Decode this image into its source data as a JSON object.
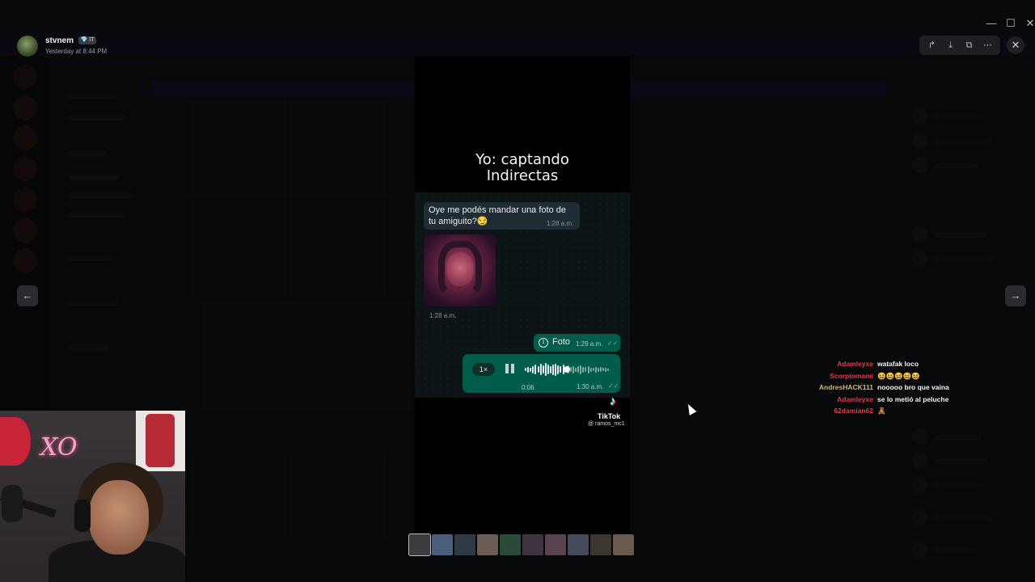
{
  "window": {
    "title": "",
    "controls": [
      "—",
      "☐",
      "✕"
    ]
  },
  "uploader": {
    "username": "stvnem",
    "badge": "💎 IT",
    "timestamp": "Yesterday at 8:44 PM"
  },
  "toolbar": {
    "share_icon": "↱",
    "download_icon": "⤓",
    "open_icon": "⧉",
    "more_icon": "⋯",
    "close_icon": "✕"
  },
  "nav": {
    "prev_icon": "←",
    "next_icon": "→"
  },
  "video": {
    "caption_line1": "Yo: captando",
    "caption_line2": "Indirectas",
    "incoming_message": "Oye me podés mandar una foto de tu amiguito?😏",
    "incoming_time": "1:28 a.m.",
    "photo_time": "1:28 a.m.",
    "foto_icon": "1",
    "foto_label": "Foto",
    "foto_time": "1:29 a.m.",
    "voice_speed": "1×",
    "voice_duration": "0:06",
    "voice_time": "1:30 a.m.",
    "read_ticks": "✓✓",
    "tiktok_logo": "♪",
    "tiktok_name": "TikTok",
    "tiktok_handle": "@ ramos_mc1"
  },
  "thumbnails": {
    "count": 10
  },
  "stream_chat": [
    {
      "user": "Adamleyxe",
      "color": "#e3394a",
      "message": "watafak loco"
    },
    {
      "user": "Scorpiomami",
      "color": "#e3394a",
      "message": "😆😆😆😆😆"
    },
    {
      "user": "AndresHACK111",
      "color": "#d8b86a",
      "message": "nooooo bro que vaina"
    },
    {
      "user": "Adamleyxe",
      "color": "#e3394a",
      "message": "se lo metió al peluche"
    },
    {
      "user": "62damian62",
      "color": "#e3394a",
      "message": "🧸"
    }
  ],
  "webcam": {
    "neon_text": "XO"
  },
  "colors": {
    "whatsapp_out": "#005c4b",
    "whatsapp_in": "#202c33",
    "chat_name_red": "#e3394a"
  }
}
